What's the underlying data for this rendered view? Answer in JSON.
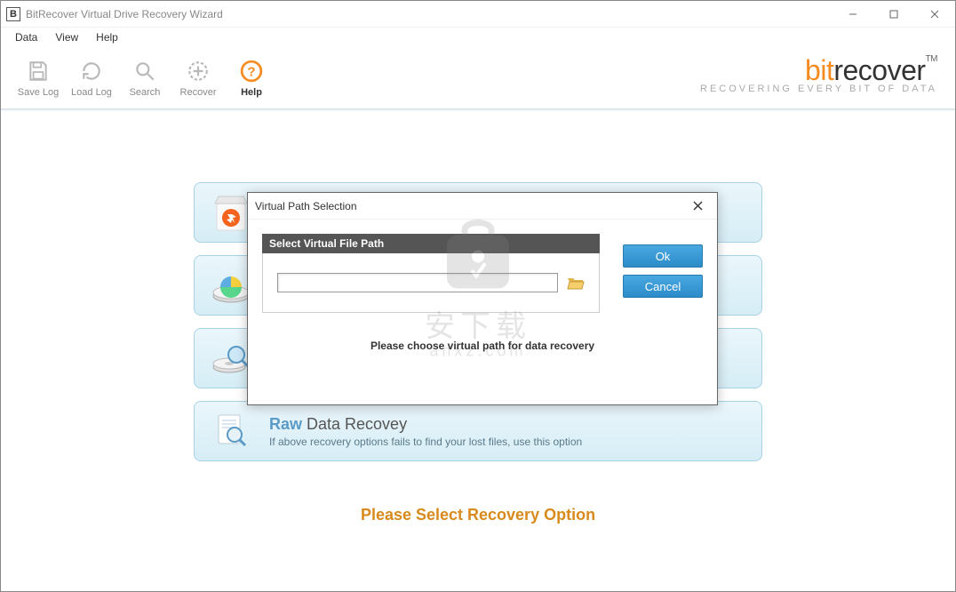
{
  "window": {
    "title": "BitRecover Virtual Drive Recovery Wizard"
  },
  "menu": {
    "items": [
      "Data",
      "View",
      "Help"
    ]
  },
  "toolbar": {
    "save_log": "Save Log",
    "load_log": "Load Log",
    "search": "Search",
    "recover": "Recover",
    "help": "Help"
  },
  "brand": {
    "prefix": "bit",
    "rest": "recover",
    "tm": "TM",
    "tagline": "RECOVERING EVERY BIT OF DATA"
  },
  "cards": {
    "raw": {
      "title_accent": "Raw",
      "title_rest": " Data Recovey",
      "desc": "If above recovery options fails to find your lost files, use this option"
    }
  },
  "footer": "Please Select Recovery Option",
  "dialog": {
    "title": "Virtual Path Selection",
    "section": "Select Virtual File Path",
    "input_value": "",
    "ok": "Ok",
    "cancel": "Cancel",
    "message": "Please choose virtual path for data recovery"
  },
  "watermark": {
    "line1": "安下载",
    "line2": "anxz.com"
  }
}
